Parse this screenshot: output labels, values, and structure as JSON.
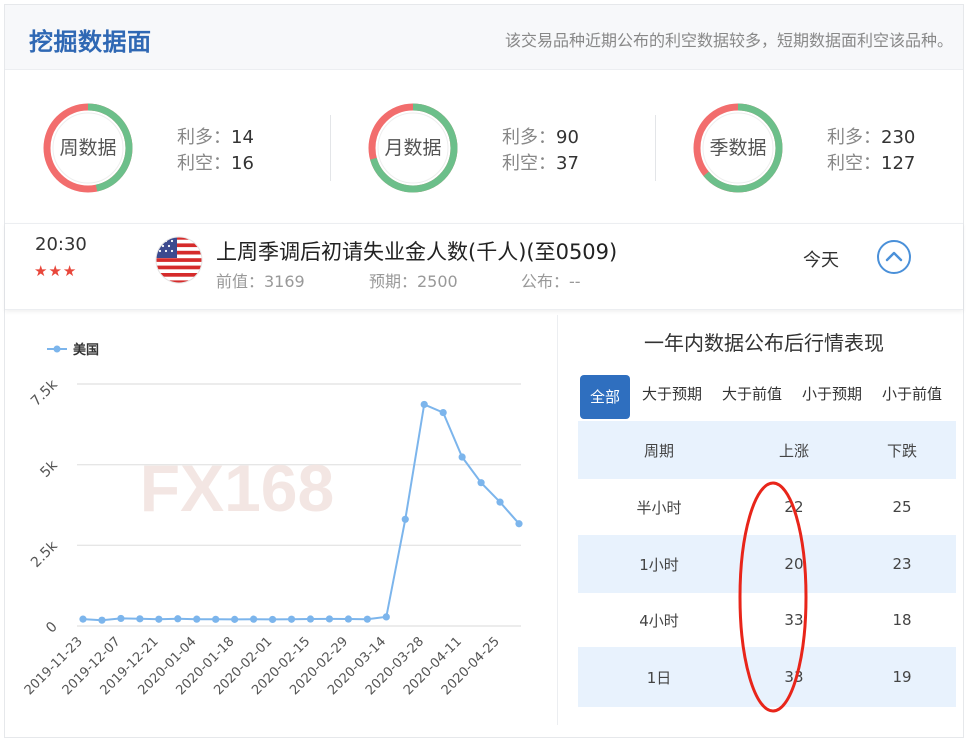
{
  "header": {
    "title": "挖掘数据面",
    "note": "该交易品种近期公布的利空数据较多，短期数据面利空该品种。"
  },
  "summary": [
    {
      "label": "周数据",
      "bull_label": "利多：",
      "bull": "14",
      "bear_label": "利空：",
      "bear": "16"
    },
    {
      "label": "月数据",
      "bull_label": "利多：",
      "bull": "90",
      "bear_label": "利空：",
      "bear": "37"
    },
    {
      "label": "季数据",
      "bull_label": "利多：",
      "bull": "230",
      "bear_label": "利空：",
      "bear": "127"
    }
  ],
  "event": {
    "time": "20:30",
    "stars": "★★★",
    "title": "上周季调后初请失业金人数(千人)(至0509)",
    "previous": "前值：3169",
    "forecast": "预期：2500",
    "actual": "公布：--",
    "date": "今天",
    "flag_icon": "us-flag-icon",
    "toggle_icon": "chevron-up-circle-icon"
  },
  "colors": {
    "bull": "#6cbf8a",
    "bear": "#f26d6d",
    "line": "#7cb5ec",
    "brand": "#2f68b4",
    "annotation": "#e8251a"
  },
  "watermark": "FX168",
  "chart_data": {
    "type": "line",
    "legend": "top-left",
    "grid": true,
    "x": [
      "2019-11-23",
      "2019-11-30",
      "2019-12-07",
      "2019-12-14",
      "2019-12-21",
      "2019-12-28",
      "2020-01-04",
      "2020-01-11",
      "2020-01-18",
      "2020-01-25",
      "2020-02-01",
      "2020-02-08",
      "2020-02-15",
      "2020-02-22",
      "2020-02-29",
      "2020-03-07",
      "2020-03-14",
      "2020-03-21",
      "2020-03-28",
      "2020-04-04",
      "2020-04-11",
      "2020-04-18",
      "2020-04-25",
      "2020-05-02"
    ],
    "xtick_labels": [
      "2019-11-23",
      "2019-12-07",
      "2019-12-21",
      "2020-01-04",
      "2020-01-18",
      "2020-02-01",
      "2020-02-15",
      "2020-02-29",
      "2020-03-14",
      "2020-03-28",
      "2020-04-11",
      "2020-04-25"
    ],
    "series": [
      {
        "name": "美国",
        "values": [
          213,
          180,
          235,
          222,
          210,
          224,
          212,
          207,
          205,
          212,
          203,
          210,
          216,
          219,
          216,
          211,
          282,
          3307,
          6867,
          6615,
          5237,
          4442,
          3839,
          3169
        ]
      }
    ],
    "ylim": [
      0,
      7500
    ],
    "yticks": [
      0,
      2500,
      5000,
      7500
    ],
    "ytick_labels": [
      "0",
      "2.5k",
      "5k",
      "7.5k"
    ]
  },
  "performance": {
    "title": "一年内数据公布后行情表现",
    "tabs": [
      "全部",
      "大于预期",
      "大于前值",
      "小于预期",
      "小于前值"
    ],
    "columns": [
      "周期",
      "上涨",
      "下跌"
    ],
    "rows": [
      {
        "period": "半小时",
        "up": "22",
        "down": "25"
      },
      {
        "period": "1小时",
        "up": "20",
        "down": "23"
      },
      {
        "period": "4小时",
        "up": "33",
        "down": "18"
      },
      {
        "period": "1日",
        "up": "33",
        "down": "19"
      }
    ]
  }
}
